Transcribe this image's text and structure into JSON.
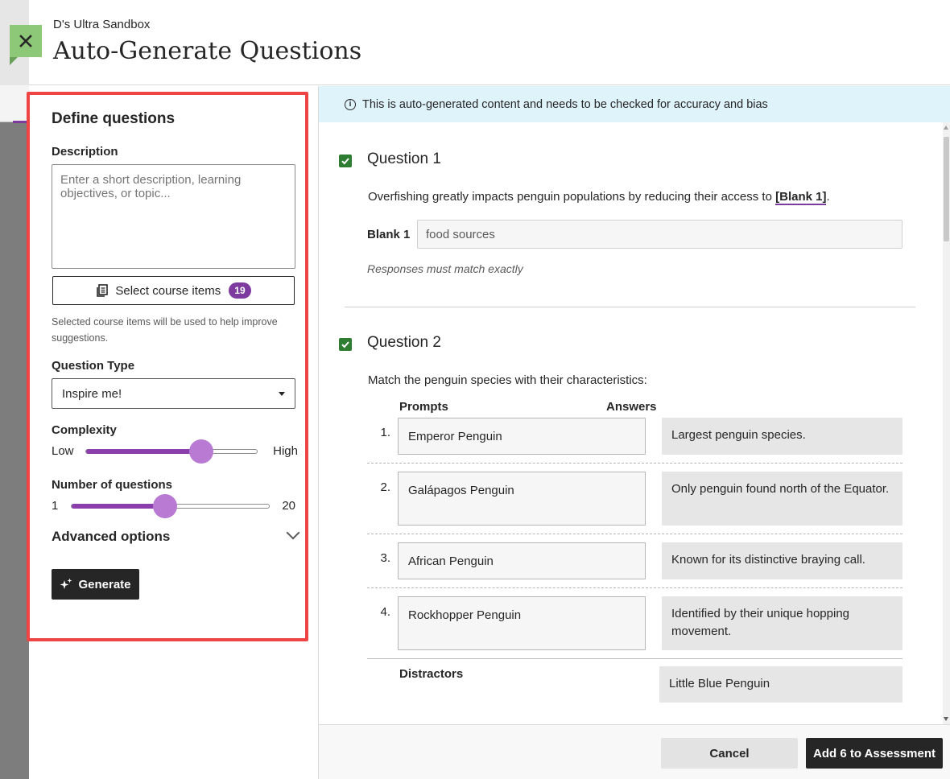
{
  "header": {
    "course_name": "D's Ultra Sandbox",
    "title": "Auto-Generate Questions"
  },
  "form": {
    "heading": "Define questions",
    "description_label": "Description",
    "description_placeholder": "Enter a short description, learning objectives, or topic...",
    "select_items_label": "Select course items",
    "select_items_count": "19",
    "helper_text": "Selected course items will be used to help improve suggestions.",
    "question_type_label": "Question Type",
    "question_type_value": "Inspire me!",
    "complexity_label": "Complexity",
    "complexity_low": "Low",
    "complexity_high": "High",
    "complexity_level": 0.67,
    "num_questions_label": "Number of questions",
    "num_min": "1",
    "num_max": "20",
    "num_level": 0.47,
    "advanced_label": "Advanced options",
    "generate_label": "Generate"
  },
  "notice": "This is auto-generated content and needs to be checked for accuracy and bias",
  "questions": [
    {
      "title": "Question 1",
      "text_before": "Overfishing greatly impacts penguin populations by reducing their access to ",
      "blank_ref": "[Blank 1]",
      "text_after": ".",
      "blank_label": "Blank 1",
      "blank_value": "food sources",
      "note": "Responses must match exactly"
    },
    {
      "title": "Question 2",
      "text": "Match the penguin species with their characteristics:",
      "prompts_header": "Prompts",
      "answers_header": "Answers",
      "pairs": [
        {
          "num": "1.",
          "prompt": "Emperor Penguin",
          "answer": "Largest penguin species."
        },
        {
          "num": "2.",
          "prompt": "Galápagos Penguin",
          "answer": "Only penguin found north of the Equator."
        },
        {
          "num": "3.",
          "prompt": "African Penguin",
          "answer": "Known for its distinctive braying call."
        },
        {
          "num": "4.",
          "prompt": "Rockhopper Penguin",
          "answer": "Identified by their unique hopping movement."
        }
      ],
      "distractors_label": "Distractors",
      "distractors": [
        "Little Blue Penguin"
      ]
    }
  ],
  "footer": {
    "cancel_label": "Cancel",
    "add_label": "Add 6 to Assessment"
  },
  "colors": {
    "accent": "#7d3ba0",
    "highlight": "#ef4444",
    "checkbox": "#2e7d32",
    "notice_bg": "#dff3fb",
    "close_bg": "#8dc878"
  }
}
